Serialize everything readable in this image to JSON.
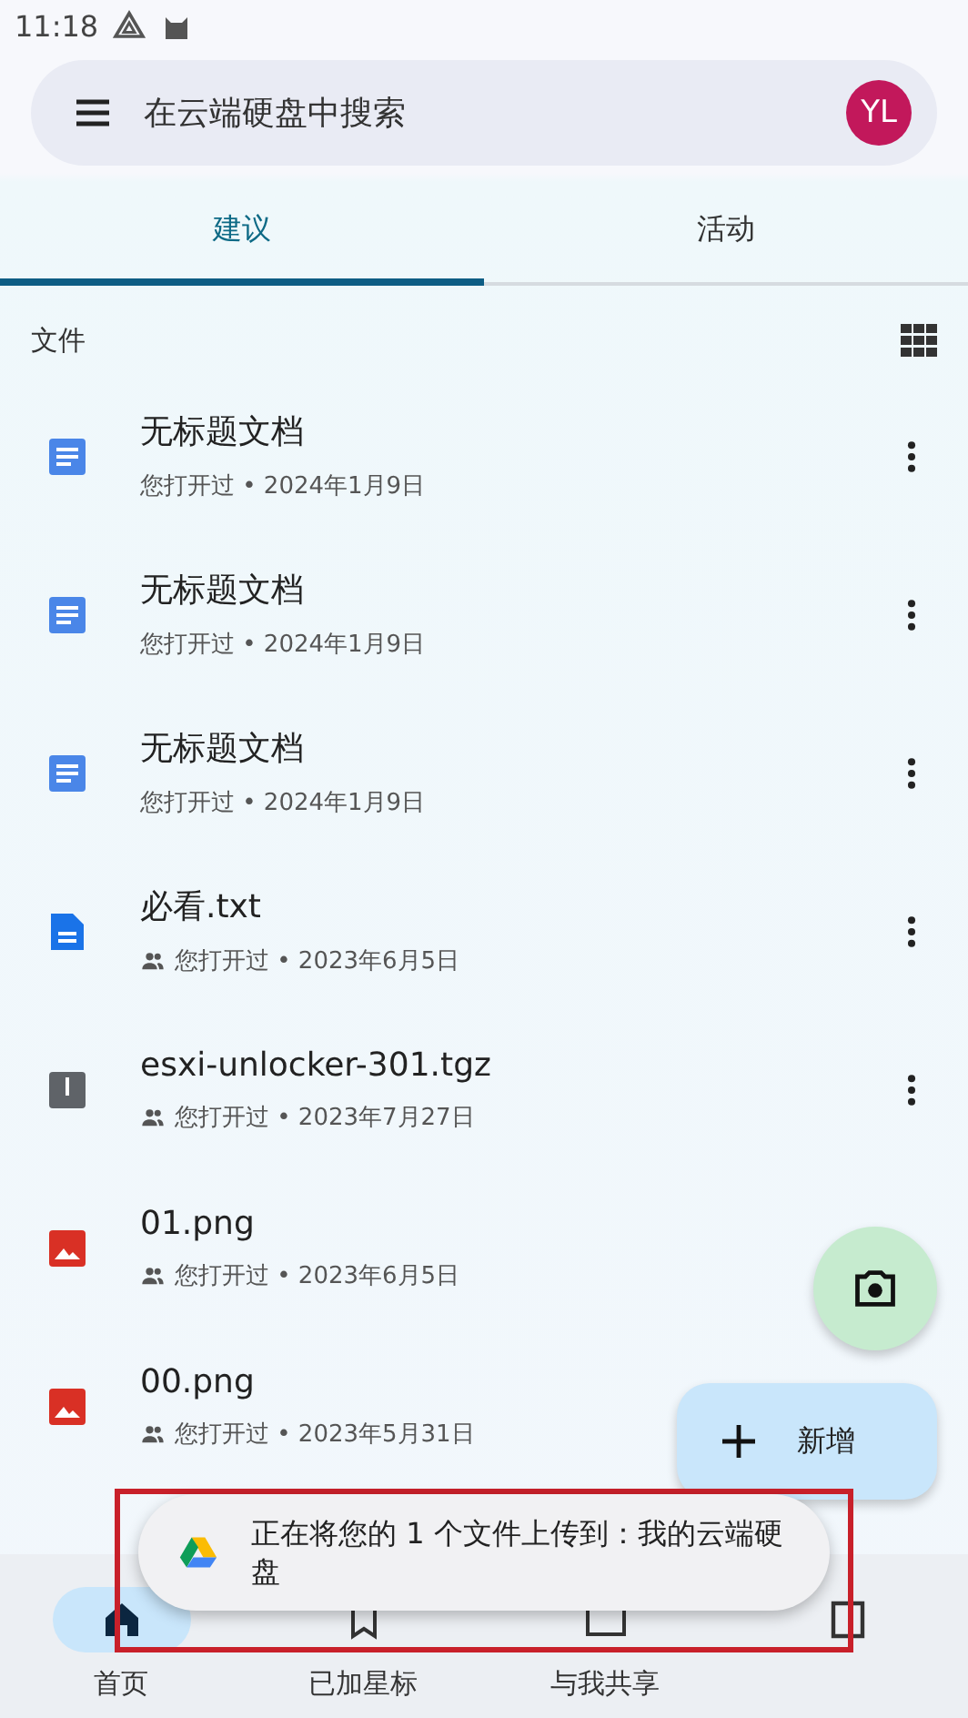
{
  "status_bar": {
    "time": "11:18"
  },
  "search": {
    "placeholder": "在云端硬盘中搜索",
    "avatar": "YL"
  },
  "tabs": [
    {
      "label": "建议",
      "selected": true
    },
    {
      "label": "活动",
      "selected": false
    }
  ],
  "section": {
    "title": "文件"
  },
  "files": [
    {
      "name": "无标题文档",
      "meta": "您打开过 • 2024年1月9日",
      "kind": "doc",
      "shared": false,
      "menu": true
    },
    {
      "name": "无标题文档",
      "meta": "您打开过 • 2024年1月9日",
      "kind": "doc",
      "shared": false,
      "menu": true
    },
    {
      "name": "无标题文档",
      "meta": "您打开过 • 2024年1月9日",
      "kind": "doc",
      "shared": false,
      "menu": true
    },
    {
      "name": "必看.txt",
      "meta": "您打开过 • 2023年6月5日",
      "kind": "text",
      "shared": true,
      "menu": true
    },
    {
      "name": "esxi-unlocker-301.tgz",
      "meta": "您打开过 • 2023年7月27日",
      "kind": "archive",
      "shared": true,
      "menu": true
    },
    {
      "name": "01.png",
      "meta": "您打开过 • 2023年6月5日",
      "kind": "image",
      "shared": true,
      "menu": false
    },
    {
      "name": "00.png",
      "meta": "您打开过 • 2023年5月31日",
      "kind": "image",
      "shared": true,
      "menu": false
    }
  ],
  "fab": {
    "label": "新增"
  },
  "toast": {
    "text": "正在将您的 1 个文件上传到：我的云端硬盘",
    "highlighted": true
  },
  "bottom_nav": [
    {
      "label": "首页",
      "selected": true,
      "kind": "home"
    },
    {
      "label": "已加星标",
      "selected": false,
      "kind": "starred"
    },
    {
      "label": "与我共享",
      "selected": false,
      "kind": "shared"
    },
    {
      "selected": false,
      "kind": "files"
    }
  ]
}
